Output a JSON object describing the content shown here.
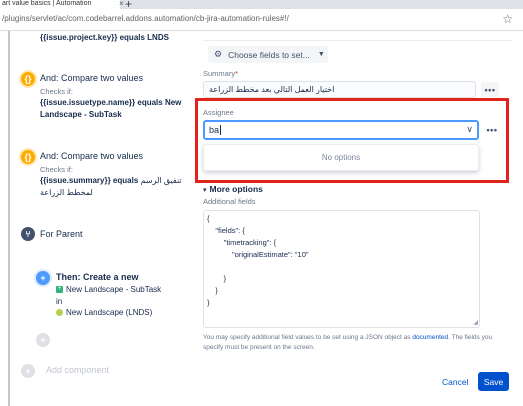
{
  "browser": {
    "tab_title": "art value basics | Automation",
    "tab_close": "×",
    "new_tab": "+",
    "url": "/plugins/servlet/ac/com.codebarrel.addons.automation/cb-jira-automation-rules#!/",
    "star_icon": "star-outline-icon"
  },
  "rule": {
    "condition0_text": "{{issue.project.key}} equals LNDS",
    "condition1": {
      "title": "And: Compare two values",
      "checks_if": "Checks if:",
      "expr_line1": "{{issue.issuetype.name}} equals New",
      "expr_line2": "Landscape - SubTask"
    },
    "condition2": {
      "title": "And: Compare two values",
      "checks_if": "Checks if:",
      "expr_bold": "{{issue.summary}} equals",
      "expr_rest": "تنفيق الرسم",
      "expr_line2": "لمخطط الزراعة"
    },
    "branch": {
      "title": "For Parent",
      "icon": "branch-icon"
    },
    "action": {
      "title": "Then: Create a new",
      "issue_type": "New Landscape - SubTask",
      "in_label": "in",
      "project": "New Landscape (LNDS)"
    },
    "add_component": "Add component"
  },
  "form": {
    "choose_fields_label": "Choose fields to set...",
    "summary_label": "Summary",
    "summary_required": "*",
    "summary_value": "اختيار العمل التالي بعد مخطط الزراعة",
    "more_dots": "•••",
    "assignee_label": "Assignee",
    "assignee_value": "ba",
    "dropdown_chevron": "⌄",
    "no_options": "No options",
    "more_options": "More options",
    "additional_fields_label": "Additional fields",
    "json_lines": [
      "{",
      "    \"fields\": {",
      "        \"timetracking\": {",
      "            \"originalEstimate\": \"10\"",
      "",
      "        }",
      "    }",
      "}"
    ],
    "help_text_prefix": "You may specify additional field values to be set using a JSON object as ",
    "help_link": "documented",
    "help_text_suffix": ". The fields you specify must be present on the screen.",
    "cancel": "Cancel",
    "save": "Save"
  },
  "colors": {
    "highlight_box": "#e2231a",
    "primary": "#0052cc",
    "condition": "#ffab00",
    "focus": "#4c9aff"
  }
}
